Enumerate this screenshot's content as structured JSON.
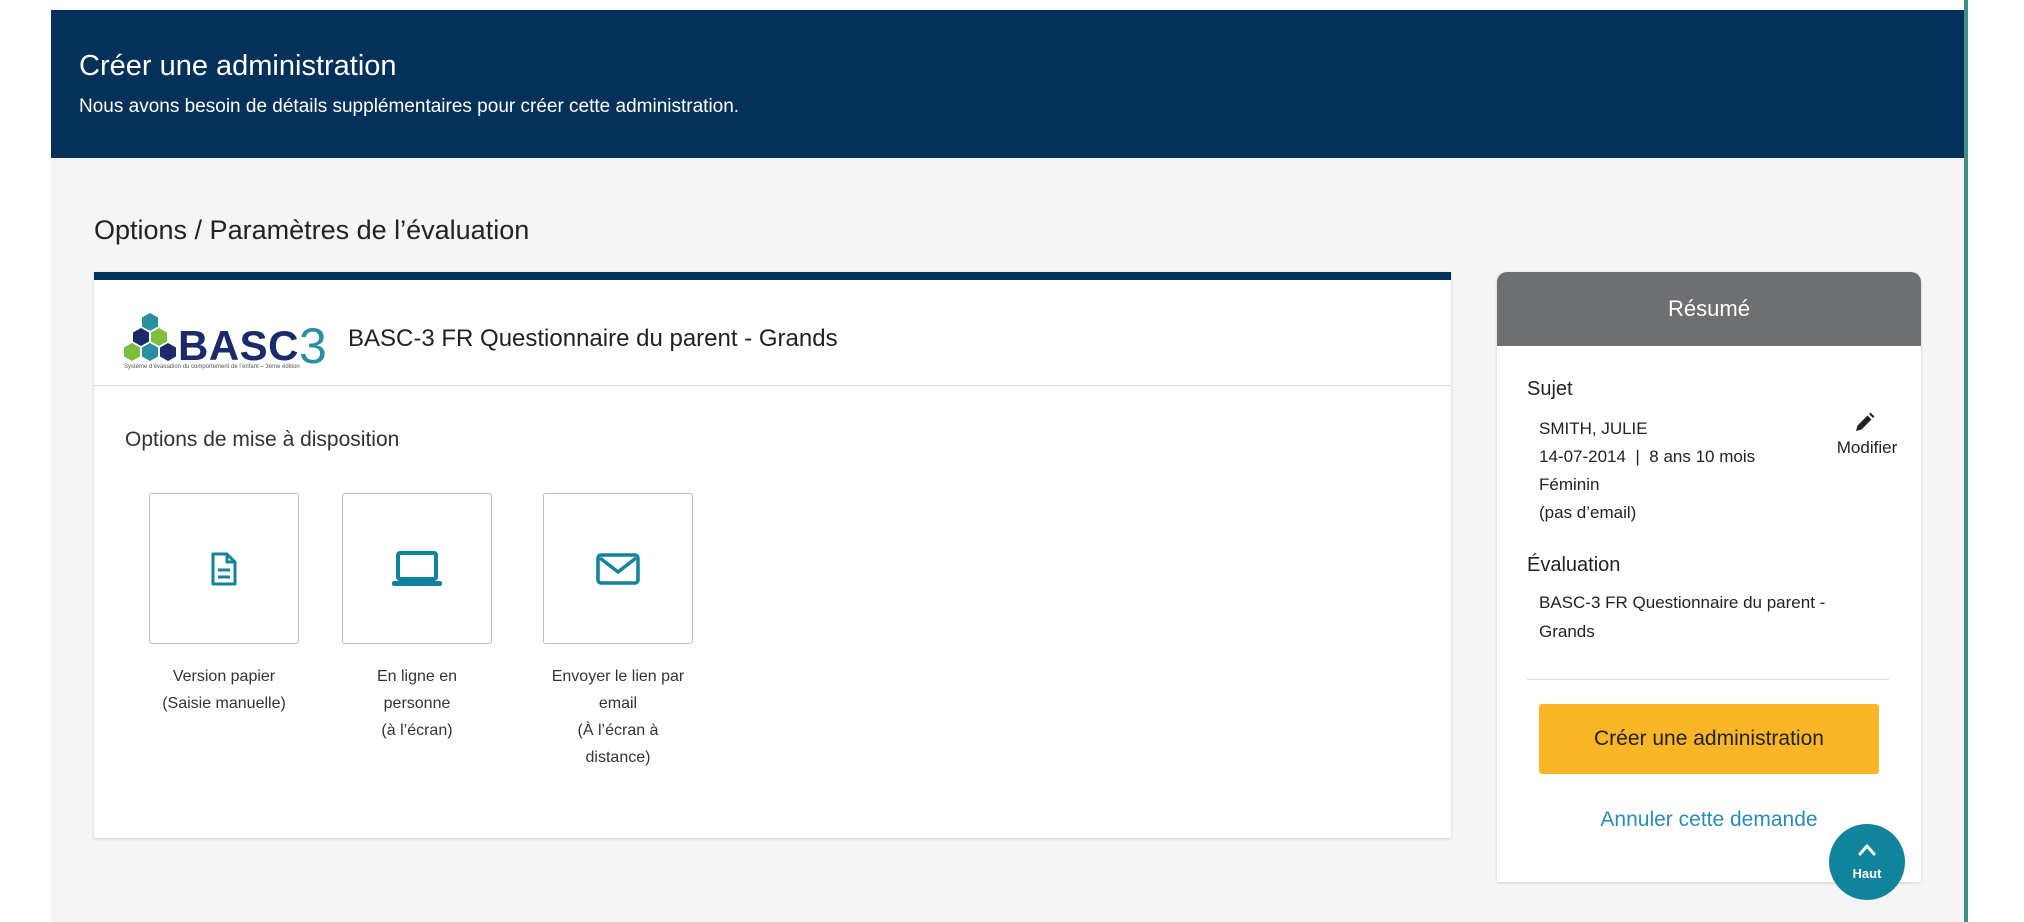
{
  "header": {
    "title": "Créer une administration",
    "subtitle": "Nous avons besoin de détails supplémentaires pour créer cette administration."
  },
  "section_title": "Options / Paramètres de l’évaluation",
  "card": {
    "logo_text": "BASC",
    "logo_number": "3",
    "logo_tagline": "Système d’évaluation du comportement de l’enfant – 3ème édition",
    "title": "BASC-3 FR Questionnaire du parent - Grands",
    "options_title": "Options de mise à disposition",
    "options": [
      {
        "icon": "document-icon",
        "label": "Version papier\n(Saisie manuelle)"
      },
      {
        "icon": "laptop-icon",
        "label": "En ligne en\npersonne\n(à l’écran)"
      },
      {
        "icon": "envelope-icon",
        "label": "Envoyer le lien par\nemail\n(À l’écran à\ndistance)"
      }
    ]
  },
  "summary": {
    "heading": "Résumé",
    "subject_label": "Sujet",
    "subject_name": "SMITH, JULIE",
    "subject_dob": "14-07-2014  |  8 ans 10 mois",
    "subject_gender": "Féminin",
    "subject_email": "(pas d’email)",
    "edit_label": "Modifier",
    "evaluation_label": "Évaluation",
    "evaluation_value": "BASC-3 FR Questionnaire du parent -\nGrands",
    "create_button": "Créer une administration",
    "cancel_link": "Annuler cette demande"
  },
  "back_to_top": {
    "label": "Haut",
    "icon": "chevron-up-icon"
  },
  "colors": {
    "header_bg": "#033159",
    "accent_teal": "#11839b",
    "cta_yellow": "#fbb627",
    "summary_head": "#6d6f70",
    "link_blue": "#2a8db3"
  }
}
